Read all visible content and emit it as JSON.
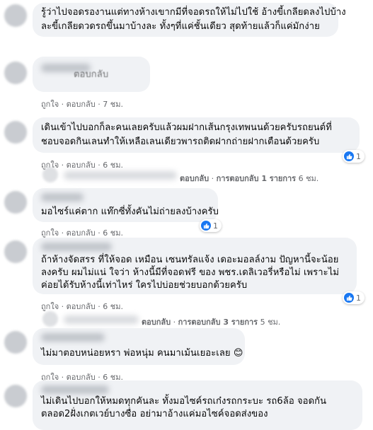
{
  "comments": [
    {
      "lines": [
        "รู้ว่าไปจอดรองานแต่ทางห้างเขากมีที่จอดรถให้ไม่ไปใช้ อ้างขี้เกลียดลงไปบ้าง",
        "ละขี้เกลียดวดรถขึ้นมาบ้างละ ทั้งๆที่แค่ชั้นเดียว สุดท้ายแล้วก็แค่มักง่าย"
      ]
    },
    {
      "lines": [
        "ตอบกลับ"
      ],
      "actions": {
        "like": "ถูกใจ",
        "reply": "ตอบกลับ",
        "time": "7 ชม."
      }
    },
    {
      "lines": [
        "เดินเข้าไปบอกก็ละคนเลยครับแล้วผมฝากเส้นกรุงเทพนนด้วยครับรถยนต์ที่",
        "ชอบจอดกินเลนทำให้เหลือเลนเดียวพารถติดฝากถ่ายฝากเตือนด้วยครับ"
      ],
      "reaction_count": "1",
      "actions": {
        "like": "ถูกใจ",
        "reply": "ตอบกลับ",
        "time": "6 ชม."
      }
    },
    {
      "reply_line": {
        "reply": "ตอบกลับ",
        "count": "การตอบกลับ 1 รายการ",
        "time": "6 ชม."
      }
    },
    {
      "lines": [
        "มอไซร์แค่ตาก แท๊กซี่ทั้งคันไม่ถ่ายลงบ้างครับ"
      ],
      "reaction_count": "1",
      "actions": {
        "like": "ถูกใจ",
        "reply": "ตอบกลับ",
        "time": "6 ชม."
      }
    },
    {
      "lines": [
        "ถ้าห้างจัดสรร ที่ให้จอด เหมือน เซนทรัลแจ้ง เดอะมอลล์งาม ปัญหานี้จะน้อย",
        "ลงครับ ผมไม่แน่ ใจว่า ห้างนี้มีที่จอดฟรี ของ พชร.เดลิเวอรี่หรือไม่ เพราะไม่",
        "ค่อยได้รับห้างนี้เท่าไหร่ ใครไปบ่อยช่วยบอกด้วยครับ"
      ],
      "reaction_count": "1",
      "actions": {
        "like": "ถูกใจ",
        "reply": "ตอบกลับ",
        "time": "6 ชม."
      }
    },
    {
      "reply_line": {
        "reply": "ตอบกลับ",
        "count": "การตอบกลับ 3 รายการ",
        "time": "5 ชม."
      }
    },
    {
      "lines": [
        "ไม่มาตอบหน่อยหรา พ่อหนุ่ม คนมาเม้นเยอะเลย 😊"
      ],
      "actions": {
        "like": "ถูกใจ",
        "reply": "ตอบกลับ",
        "time": "6 ชม."
      }
    },
    {
      "lines": [
        "ไม่เดินไปบอกให้หมดทุกคันละ ทั้งมอไซค์รถเก๋งรถกระบะ รถ6ล้อ จอดกัน",
        "ตลอด2ฝั่งเกตเวย์บางซื่อ อย่ามาอ้างแค่มอไซค์จอดส่งของ"
      ]
    }
  ],
  "icons": {
    "like": "thumbs-up-icon"
  },
  "colors": {
    "bubble": "#f0f2f5",
    "meta": "#65676b",
    "like": "#1877f2"
  }
}
